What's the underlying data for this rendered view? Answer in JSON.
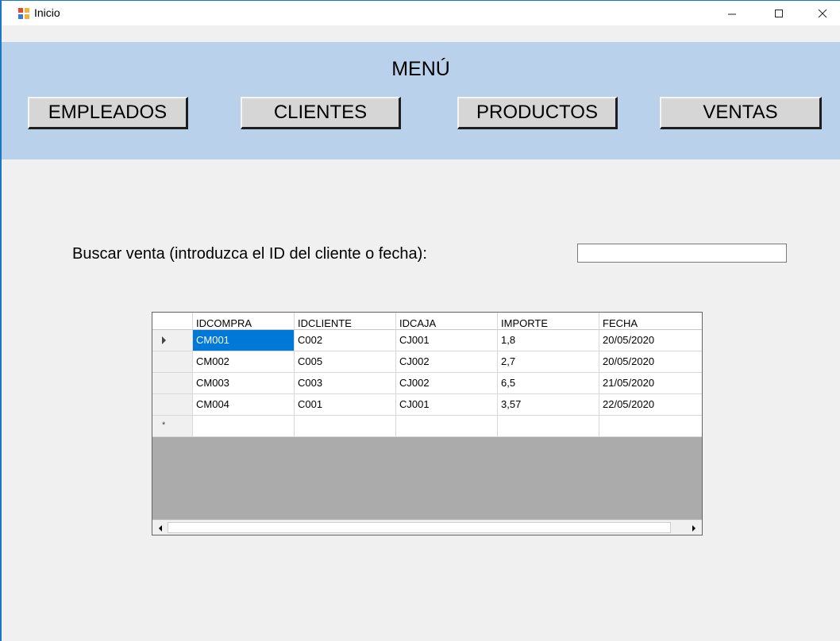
{
  "window": {
    "title": "Inicio",
    "controls": [
      "minimize",
      "maximize",
      "close"
    ]
  },
  "menu": {
    "title": "MENÚ",
    "buttons": {
      "empleados": "EMPLEADOS",
      "clientes": "CLIENTES",
      "productos": "PRODUCTOS",
      "ventas": "VENTAS"
    }
  },
  "search": {
    "label": "Buscar venta (introduzca el ID del cliente o fecha):",
    "value": ""
  },
  "grid": {
    "columns": [
      "IDCOMPRA",
      "IDCLIENTE",
      "IDCAJA",
      "IMPORTE",
      "FECHA"
    ],
    "rows": [
      [
        "CM001",
        "C002",
        "CJ001",
        "1,8",
        "20/05/2020"
      ],
      [
        "CM002",
        "C005",
        "CJ002",
        "2,7",
        "20/05/2020"
      ],
      [
        "CM003",
        "C003",
        "CJ002",
        "6,5",
        "21/05/2020"
      ],
      [
        "CM004",
        "C001",
        "CJ001",
        "3,57",
        "22/05/2020"
      ]
    ],
    "selected_cell": [
      0,
      0
    ],
    "new_row_marker": "*"
  },
  "colors": {
    "menu_band": "#b9d1ea",
    "form_background": "#f0f0f0",
    "selection": "#0078d7",
    "grid_empty_area": "#ababab"
  }
}
